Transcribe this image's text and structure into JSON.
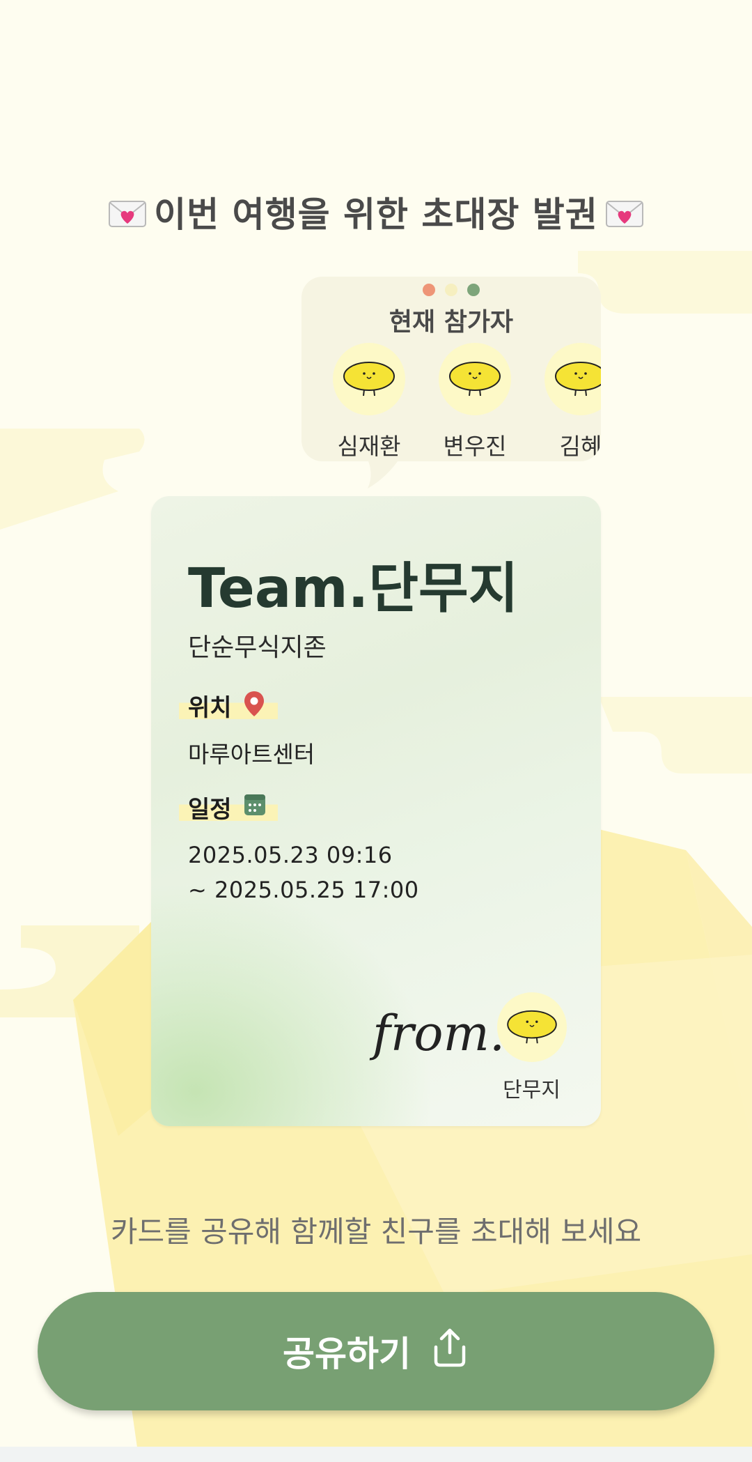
{
  "headline": {
    "text": "이번 여행을 위한 초대장 발권",
    "left_icon": "love-letter-icon",
    "right_icon": "love-letter-icon"
  },
  "participants_bubble": {
    "title": "현재 참가자",
    "window_dots": [
      "#ee9577",
      "#f6efc0",
      "#7ea57a"
    ],
    "members": [
      {
        "name": "심재환",
        "avatar": "pickled-radish-character"
      },
      {
        "name": "변우진",
        "avatar": "pickled-radish-character"
      },
      {
        "name": "김혜",
        "avatar": "pickled-radish-character"
      }
    ]
  },
  "card": {
    "title": "Team.단무지",
    "subtitle": "단순무식지존",
    "location_label": "위치",
    "location_icon": "map-pin-icon",
    "location_value": "마루아트센터",
    "schedule_label": "일정",
    "schedule_icon": "calendar-icon",
    "schedule_start": "2025.05.23 09:16",
    "schedule_end": "~ 2025.05.25 17:00",
    "from_label": "from.",
    "from_name": "단무지"
  },
  "invite_hint": "카드를 공유해 함께할 친구를 초대해 보세요",
  "share_button": {
    "label": "공유하기",
    "icon": "share-upload-icon"
  },
  "colors": {
    "background": "#fefdf0",
    "accent_green": "#78a073",
    "card_title": "#253a30",
    "highlight_yellow": "#fbf3b6",
    "pin_red": "#d9534f"
  }
}
